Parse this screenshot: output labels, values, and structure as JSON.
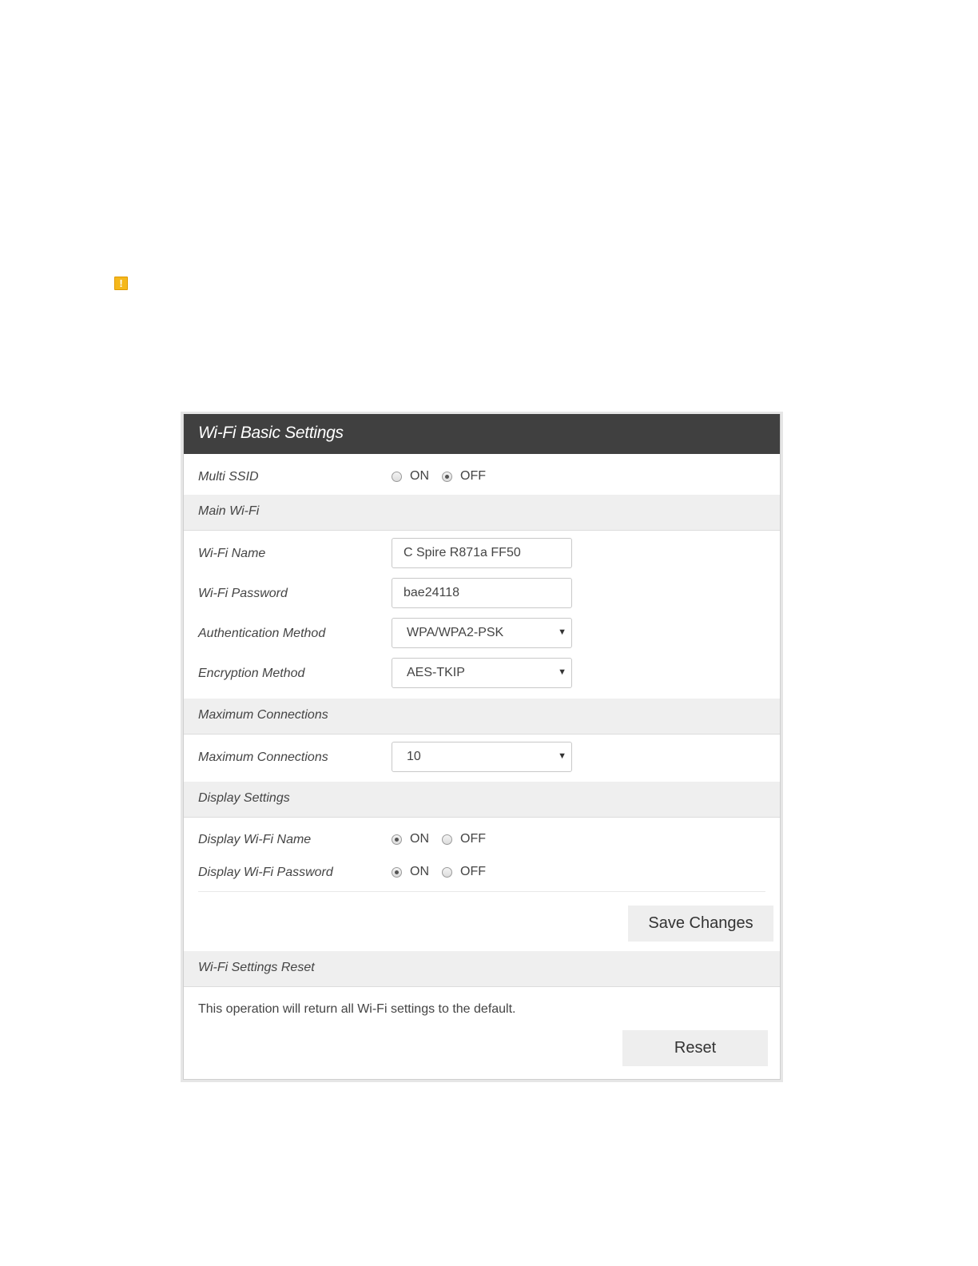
{
  "warning_icon": {
    "glyph": "!",
    "color": "#f5b81c"
  },
  "panel": {
    "title": "Wi-Fi Basic Settings",
    "header_color": "#404040"
  },
  "multi_ssid": {
    "label": "Multi SSID",
    "on_label": "ON",
    "off_label": "OFF",
    "selected": "OFF"
  },
  "main_wifi": {
    "section_label": "Main Wi-Fi",
    "name_label": "Wi-Fi Name",
    "name_value": "C Spire R871a FF50",
    "password_label": "Wi-Fi Password",
    "password_value": "bae24118",
    "auth_label": "Authentication Method",
    "auth_value": "WPA/WPA2-PSK",
    "encryption_label": "Encryption Method",
    "encryption_value": "AES-TKIP"
  },
  "max_connections": {
    "section_label": "Maximum Connections",
    "label": "Maximum Connections",
    "value": "10"
  },
  "display_settings": {
    "section_label": "Display Settings",
    "name_label": "Display Wi-Fi Name",
    "name_on": "ON",
    "name_off": "OFF",
    "name_selected": "ON",
    "password_label": "Display Wi-Fi Password",
    "password_on": "ON",
    "password_off": "OFF",
    "password_selected": "ON"
  },
  "save_button": "Save Changes",
  "reset_section": {
    "section_label": "Wi-Fi Settings Reset",
    "description": "This operation will return all Wi-Fi settings to the default.",
    "button": "Reset"
  },
  "caret_glyph": "▼"
}
